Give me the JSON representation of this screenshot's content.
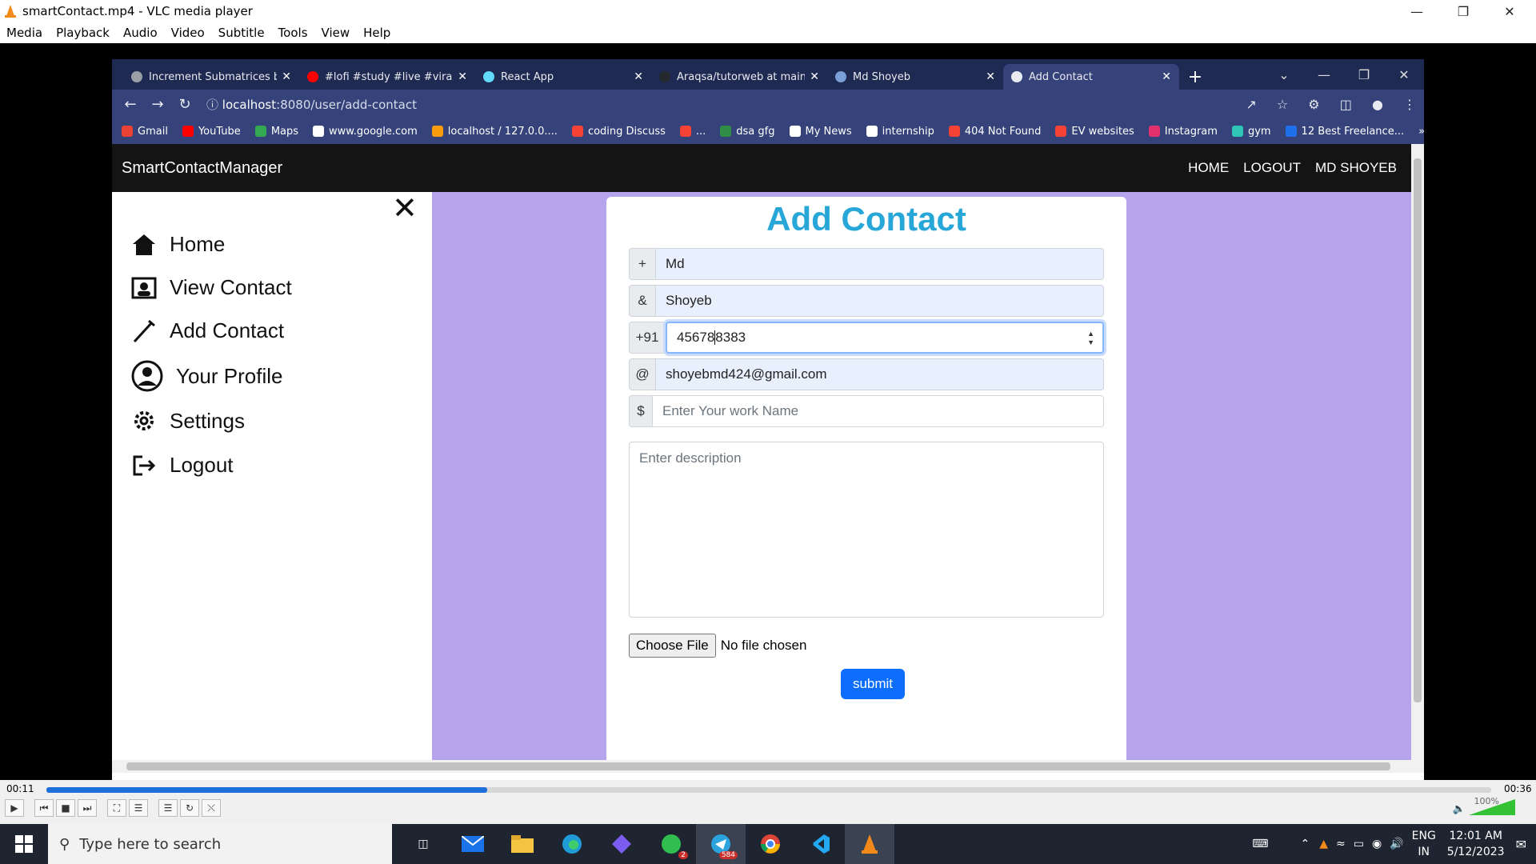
{
  "vlc": {
    "title": "smartContact.mp4 - VLC media player",
    "menu": [
      "Media",
      "Playback",
      "Audio",
      "Video",
      "Subtitle",
      "Tools",
      "View",
      "Help"
    ],
    "time_elapsed": "00:11",
    "time_total": "00:36",
    "progress": 0.305,
    "volume_label": "100%"
  },
  "browser": {
    "tabs": [
      {
        "label": "Increment Submatrices by (",
        "color": "#9aa0a6"
      },
      {
        "label": "#lofi #study #live #viral #hi",
        "color": "#ff0000"
      },
      {
        "label": "React App",
        "color": "#61dafb"
      },
      {
        "label": "Araqsa/tutorweb at main · /",
        "color": "#24292f"
      },
      {
        "label": "Md Shoyeb",
        "color": "#7aa0d8"
      },
      {
        "label": "Add Contact",
        "color": "#e8eaf0"
      }
    ],
    "url_host": "localhost",
    "url_path": ":8080/user/add-contact",
    "bookmarks": [
      {
        "label": "Gmail",
        "color": "#ea4335"
      },
      {
        "label": "YouTube",
        "color": "#ff0000"
      },
      {
        "label": "Maps",
        "color": "#34a853"
      },
      {
        "label": "www.google.com",
        "color": "#ffffff"
      },
      {
        "label": "localhost / 127.0.0....",
        "color": "#f89c0e"
      },
      {
        "label": "coding Discuss",
        "color": "#f44336"
      },
      {
        "label": "...",
        "color": "#f44336"
      },
      {
        "label": "dsa gfg",
        "color": "#2f8d46"
      },
      {
        "label": "My News",
        "color": "#ffffff"
      },
      {
        "label": "internship",
        "color": "#ffffff"
      },
      {
        "label": "404 Not Found",
        "color": "#f44336"
      },
      {
        "label": "EV websites",
        "color": "#f44336"
      },
      {
        "label": "Instagram",
        "color": "#e1306c"
      },
      {
        "label": "gym",
        "color": "#2ec4b6"
      },
      {
        "label": "12 Best Freelance...",
        "color": "#1f6feb"
      }
    ]
  },
  "app": {
    "brand": "SmartContactManager",
    "nav": [
      "HOME",
      "LOGOUT",
      "MD SHOYEB"
    ],
    "sidebar": [
      "Home",
      "View Contact",
      "Add Contact",
      "Your Profile",
      "Settings",
      "Logout"
    ],
    "form": {
      "title": "Add Contact",
      "first_name_prefix": "+",
      "first_name": "Md",
      "last_name_prefix": "&",
      "last_name": "Shoyeb",
      "phone_prefix": "+91",
      "phone_a": "45678",
      "phone_b": "8383",
      "email_prefix": "@",
      "email": "shoyebmd424@gmail.com",
      "work_prefix": "$",
      "work_placeholder": "Enter Your work Name",
      "description_placeholder": "Enter description",
      "file_button": "Choose File",
      "file_status": "No file chosen",
      "submit": "submit"
    }
  },
  "taskbar": {
    "search_placeholder": "Type here to search",
    "whatsapp_badge": "2",
    "telegram_badge": "584",
    "lang_1": "ENG",
    "lang_2": "IN",
    "time": "12:01 AM",
    "date": "5/12/2023",
    "notifications": "1"
  }
}
